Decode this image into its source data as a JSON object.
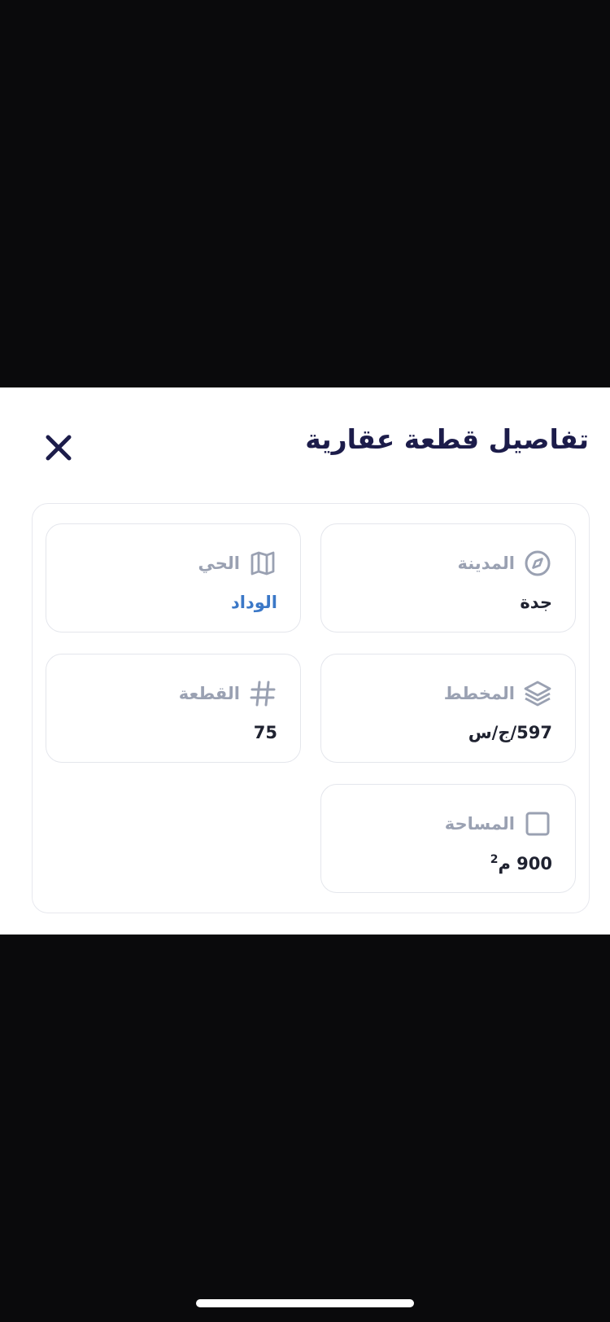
{
  "sheet": {
    "title": "تفاصيل قطعة عقارية",
    "close_icon": "close-icon"
  },
  "details": {
    "city": {
      "label": "المدينة",
      "value": "جدة",
      "icon": "compass-icon"
    },
    "district": {
      "label": "الحي",
      "value": "الوداد",
      "icon": "map-icon"
    },
    "plan": {
      "label": "المخطط",
      "value": "597/ج/س",
      "icon": "layers-icon"
    },
    "plot": {
      "label": "القطعة",
      "value": "75",
      "icon": "hash-icon"
    },
    "area": {
      "label": "المساحة",
      "value": "900",
      "unit": "م",
      "unit_power": "2",
      "icon": "square-icon"
    }
  },
  "colors": {
    "title": "#1c1c4a",
    "label": "#9aa1b2",
    "value": "#1f2230",
    "link": "#3b78c7",
    "backdrop": "#0a0a0c"
  }
}
